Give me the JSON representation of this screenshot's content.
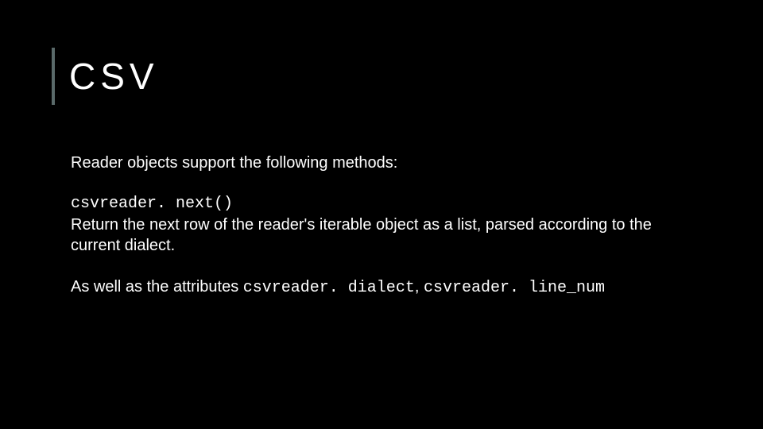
{
  "title": "CSV",
  "intro": "Reader objects support the following methods:",
  "method_code": "csvreader. next()",
  "method_desc": "Return the next row of the reader's iterable object as a list, parsed according to the current dialect.",
  "attrs_prefix": "As well as the attributes ",
  "attr1": "csvreader. dialect",
  "attrs_sep": ", ",
  "attr2": "csvreader. line_num"
}
